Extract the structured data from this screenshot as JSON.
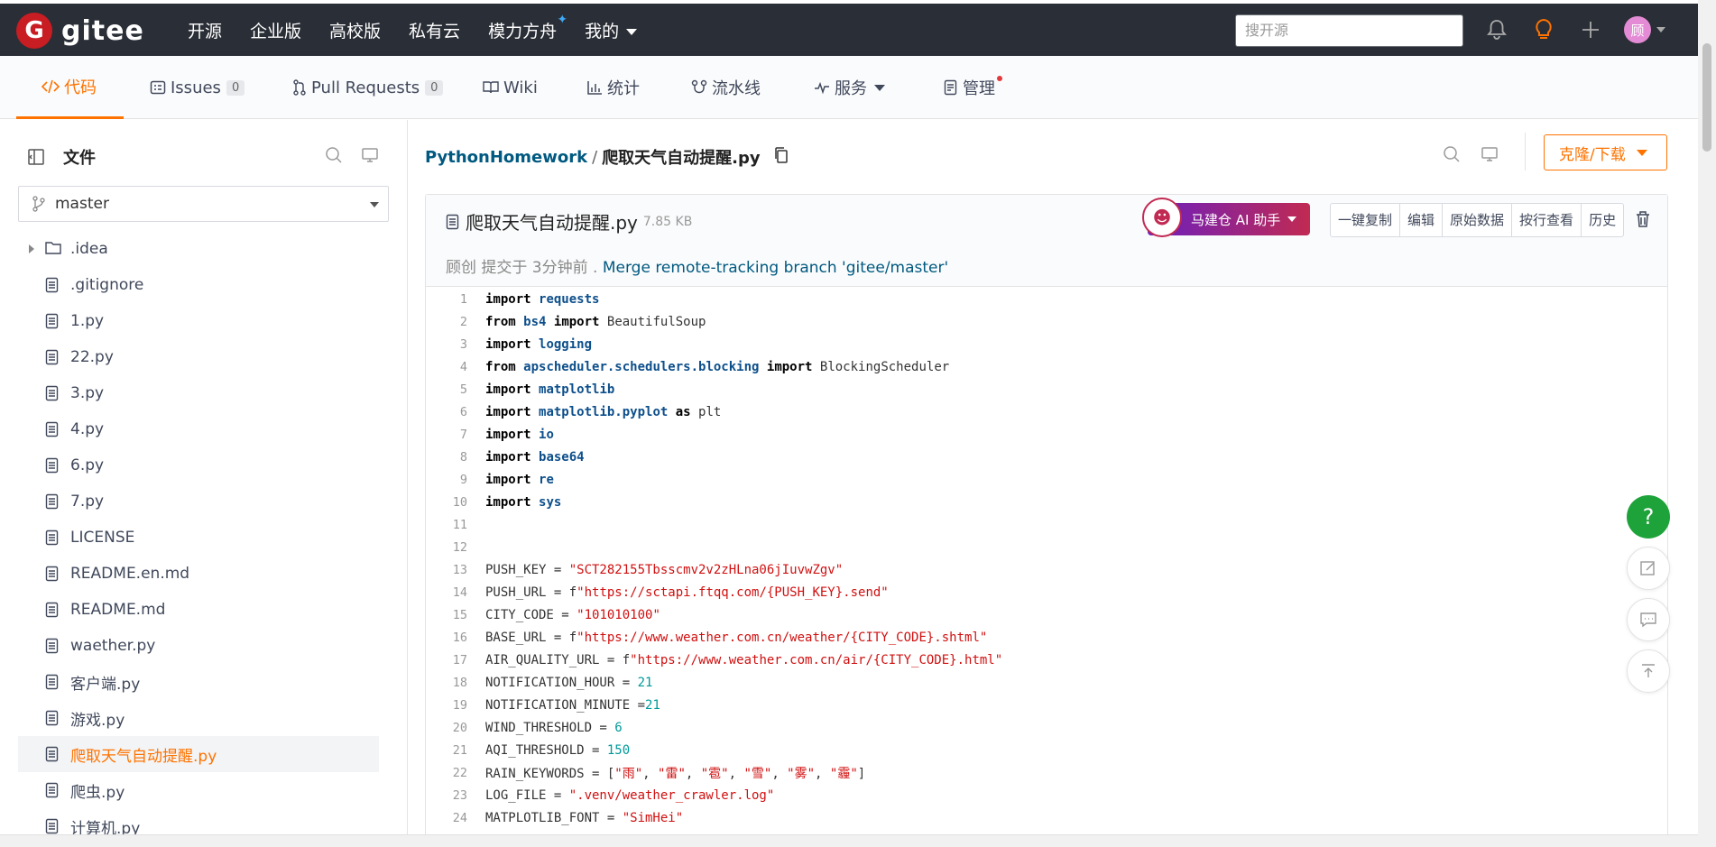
{
  "topbar": {
    "logo_letter": "G",
    "logo_text": "gitee",
    "nav": [
      "开源",
      "企业版",
      "高校版",
      "私有云",
      "模力方舟",
      "我的"
    ],
    "search_placeholder": "搜开源",
    "avatar_text": "顾"
  },
  "tabs": {
    "code": "代码",
    "issues": "Issues",
    "issues_count": "0",
    "pulls": "Pull Requests",
    "pulls_count": "0",
    "wiki": "Wiki",
    "stats": "统计",
    "pipeline": "流水线",
    "services": "服务",
    "manage": "管理"
  },
  "sidebar": {
    "title": "文件",
    "branch": "master",
    "items": [
      {
        "name": ".idea",
        "type": "folder"
      },
      {
        "name": ".gitignore",
        "type": "file"
      },
      {
        "name": "1.py",
        "type": "file"
      },
      {
        "name": "22.py",
        "type": "file"
      },
      {
        "name": "3.py",
        "type": "file"
      },
      {
        "name": "4.py",
        "type": "file"
      },
      {
        "name": "6.py",
        "type": "file"
      },
      {
        "name": "7.py",
        "type": "file"
      },
      {
        "name": "LICENSE",
        "type": "file"
      },
      {
        "name": "README.en.md",
        "type": "file"
      },
      {
        "name": "README.md",
        "type": "file"
      },
      {
        "name": "waether.py",
        "type": "file"
      },
      {
        "name": "客户端.py",
        "type": "file"
      },
      {
        "name": "游戏.py",
        "type": "file"
      },
      {
        "name": "爬取天气自动提醒.py",
        "type": "file",
        "active": true
      },
      {
        "name": "爬虫.py",
        "type": "file"
      },
      {
        "name": "计算机.py",
        "type": "file"
      }
    ]
  },
  "main": {
    "repo": "PythonHomework",
    "file": "爬取天气自动提醒.py",
    "clone_label": "克隆/下载",
    "file_size": "7.85 KB",
    "ai_label": "马建仓 AI 助手",
    "actions": [
      "一键复制",
      "编辑",
      "原始数据",
      "按行查看",
      "历史"
    ],
    "commit_author": "顾创",
    "commit_time": "提交于 3分钟前 .",
    "commit_msg": "Merge remote-tracking branch 'gitee/master'"
  },
  "code_lines": [
    "import requests",
    "from bs4 import BeautifulSoup",
    "import logging",
    "from apscheduler.schedulers.blocking import BlockingScheduler",
    "import matplotlib",
    "import matplotlib.pyplot as plt",
    "import io",
    "import base64",
    "import re",
    "import sys",
    "",
    "",
    "PUSH_KEY = \"SCT282155Tbsscmv2v2zHLna06jIuvwZgv\"",
    "PUSH_URL = f\"https://sctapi.ftqq.com/{PUSH_KEY}.send\"",
    "CITY_CODE = \"101010100\"",
    "BASE_URL = f\"https://www.weather.com.cn/weather/{CITY_CODE}.shtml\"",
    "AIR_QUALITY_URL = f\"https://www.weather.com.cn/air/{CITY_CODE}.html\"",
    "NOTIFICATION_HOUR = 21",
    "NOTIFICATION_MINUTE =21",
    "WIND_THRESHOLD = 6",
    "AQI_THRESHOLD = 150",
    "RAIN_KEYWORDS = [\"雨\", \"雷\", \"雹\", \"雪\", \"雾\", \"霾\"]",
    "LOG_FILE = \".venv/weather_crawler.log\"",
    "MATPLOTLIB_FONT = \"SimHei\""
  ],
  "float_help": "?",
  "colors": {
    "accent": "#fe7300",
    "topbar": "#2a2e36",
    "brand": "#c71d23",
    "link": "#005980"
  }
}
